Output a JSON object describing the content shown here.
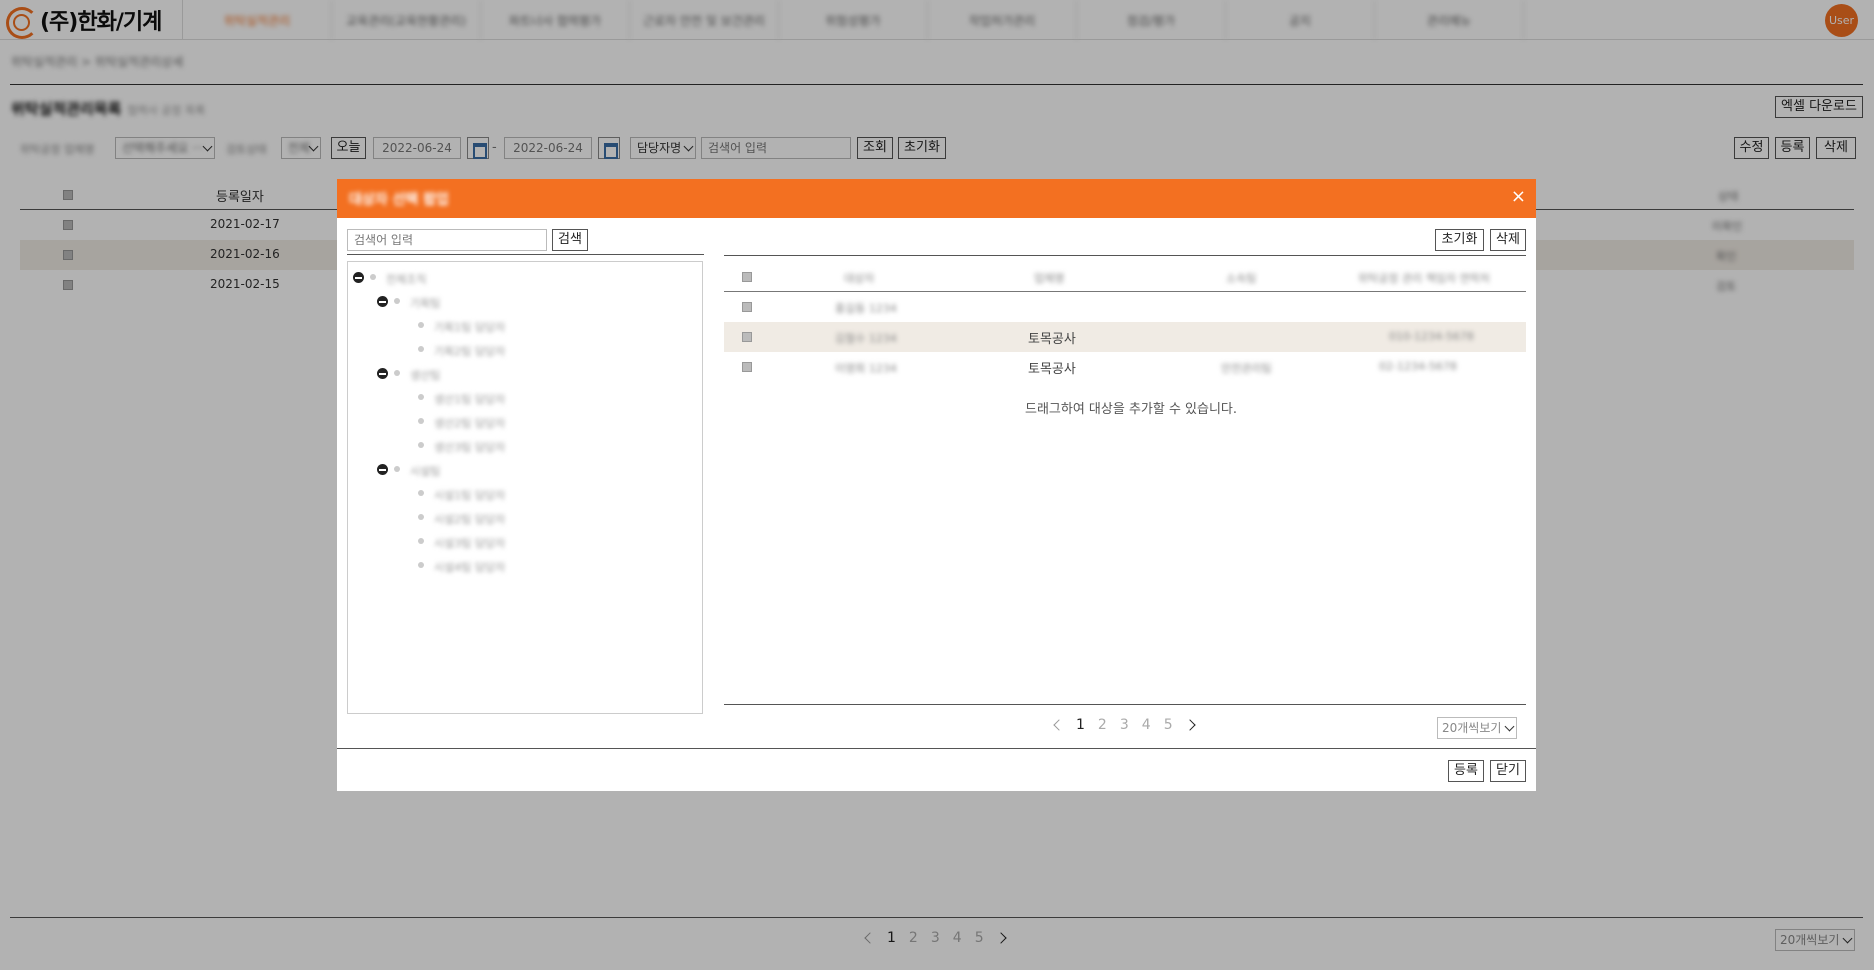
{
  "brand": {
    "logo_text": "(주)한화/기계",
    "accent": "#f37021"
  },
  "nav": {
    "items": [
      {
        "label": "위탁실적관리"
      },
      {
        "label": "교육관리(교육현황관리)"
      },
      {
        "label": "파트너사 협력평가"
      },
      {
        "label": "근로자 안전 및 보건관리"
      },
      {
        "label": "위험성평가"
      },
      {
        "label": "작업허가관리"
      },
      {
        "label": "점검/평가"
      },
      {
        "label": "공지"
      },
      {
        "label": "관리메뉴"
      }
    ],
    "user_label": "User"
  },
  "breadcrumb": "위탁실적관리 > 위탁실적관리상세",
  "page": {
    "title": "위탁실적관리목록",
    "subtitle": "협력사 공정 목록",
    "excel_button": "엑셀 다운로드"
  },
  "filters": {
    "filter1_label": "위탁공정 업체명",
    "filter1_value": "선택해주세요 ···",
    "filter2_label": "검토상태",
    "filter2_value": "전체",
    "today_button": "오늘",
    "date_from": "2022-06-24",
    "date_sep": "-",
    "date_to": "2022-06-24",
    "search_type": "담당자명",
    "search_placeholder": "검색어 입력",
    "search_button": "조회",
    "reset_button": "초기화",
    "edit_button": "수정",
    "register_button": "등록",
    "delete_button": "삭제"
  },
  "table": {
    "col_date": "등록일자",
    "col_last": "상태",
    "rows": [
      {
        "date": "2021-02-17",
        "last": "미확인"
      },
      {
        "date": "2021-02-16",
        "last": "확인"
      },
      {
        "date": "2021-02-15",
        "last": "검토"
      }
    ]
  },
  "pagination": {
    "pages": [
      "1",
      "2",
      "3",
      "4",
      "5"
    ],
    "current": "1",
    "page_size": "20개씩보기"
  },
  "modal": {
    "title": "대상자 선택 팝업",
    "close_icon": "×",
    "search_placeholder": "검색어 입력",
    "search_button": "검색",
    "reset_button": "초기화",
    "delete_button": "삭제",
    "tree": {
      "root": "전체조직",
      "groups": [
        {
          "label": "기획팀",
          "children": [
            "기획1팀 담당자",
            "기획2팀 담당자"
          ]
        },
        {
          "label": "생산팀",
          "children": [
            "생산1팀 담당자",
            "생산2팀 담당자",
            "생산3팀 담당자"
          ]
        },
        {
          "label": "시설팀",
          "children": [
            "시설1팀 담당자",
            "시설2팀 담당자",
            "시설3팀 담당자",
            "시설4팀 담당자"
          ]
        }
      ]
    },
    "columns": [
      "대상자",
      "업체명",
      "소속팀",
      "위탁공정 관리 책임자 연락처"
    ],
    "rows": [
      {
        "name": "홍길동 1234",
        "company": "",
        "team": "",
        "contact": ""
      },
      {
        "name": "김철수 1234",
        "company": "토목공사",
        "team": "",
        "contact": "010-1234-5678"
      },
      {
        "name": "이영희 1234",
        "company": "토목공사",
        "team": "안전관리팀",
        "contact": "02-1234-5678"
      }
    ],
    "drag_hint": "드래그하여 대상을 추가할 수 있습니다.",
    "pagination": {
      "pages": [
        "1",
        "2",
        "3",
        "4",
        "5"
      ],
      "current": "1",
      "page_size": "20개씩보기"
    },
    "register_button": "등록",
    "close_button": "닫기"
  }
}
